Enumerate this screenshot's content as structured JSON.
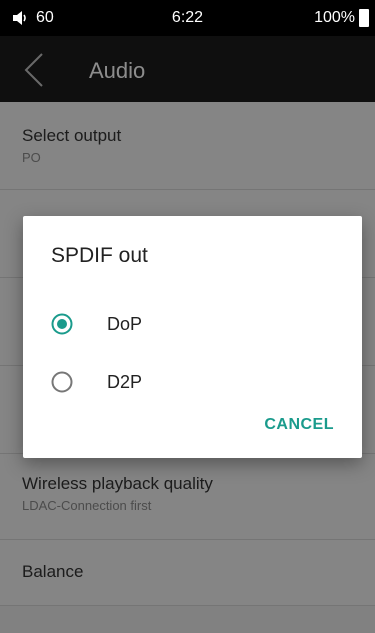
{
  "status_bar": {
    "volume": "60",
    "time": "6:22",
    "battery": "100%"
  },
  "app_bar": {
    "title": "Audio"
  },
  "settings": [
    {
      "title": "Select output",
      "subtitle": "PO"
    },
    {
      "title": "",
      "subtitle": ""
    },
    {
      "title": "",
      "subtitle": ""
    },
    {
      "title": "",
      "subtitle": ""
    },
    {
      "title": "Wireless playback quality",
      "subtitle": "LDAC-Connection first"
    },
    {
      "title": "Balance",
      "subtitle": ""
    }
  ],
  "dialog": {
    "title": "SPDIF out",
    "options": [
      {
        "label": "DoP",
        "selected": true
      },
      {
        "label": "D2P",
        "selected": false
      }
    ],
    "cancel_label": "CANCEL"
  },
  "colors": {
    "accent": "#1a9b8c",
    "status_bar_bg": "#000000",
    "app_bar_bg": "#1d1d1d"
  }
}
